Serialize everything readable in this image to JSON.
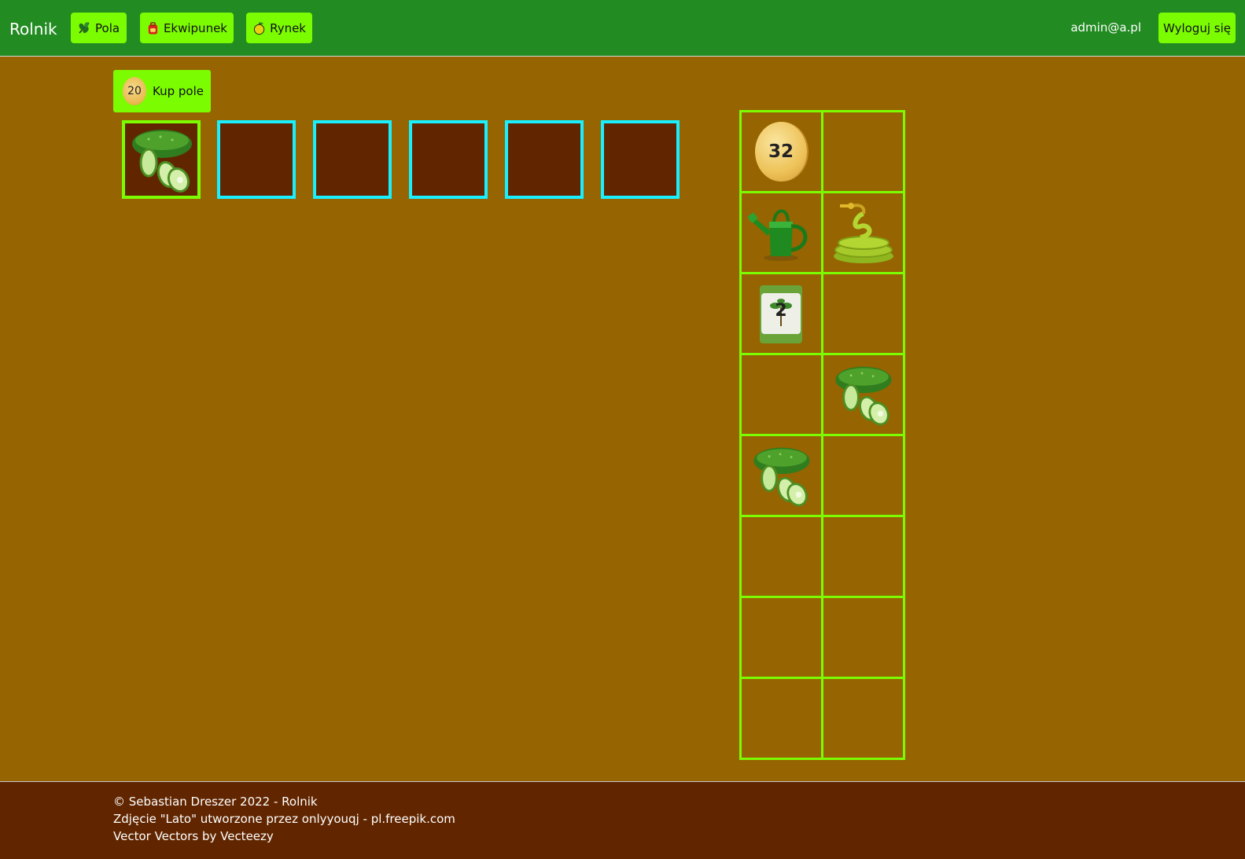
{
  "navbar": {
    "brand": "Rolnik",
    "links": [
      {
        "label": "Pola",
        "icon": "plant-icon"
      },
      {
        "label": "Ekwipunek",
        "icon": "backpack-icon"
      },
      {
        "label": "Rynek",
        "icon": "apple-icon"
      }
    ],
    "user_email": "admin@a.pl",
    "logout_label": "Wyloguj się"
  },
  "fields": {
    "buy_price": "20",
    "buy_label": "Kup pole",
    "plots": [
      {
        "state": "owned",
        "crop": "cucumber"
      },
      {
        "state": "empty"
      },
      {
        "state": "empty"
      },
      {
        "state": "empty"
      },
      {
        "state": "empty"
      },
      {
        "state": "empty"
      }
    ]
  },
  "inventory": {
    "slots": [
      {
        "item": "coin",
        "amount": "32"
      },
      {
        "item": "empty"
      },
      {
        "item": "watering-can"
      },
      {
        "item": "garden-hose"
      },
      {
        "item": "seed-bag",
        "amount": "2"
      },
      {
        "item": "empty"
      },
      {
        "item": "empty"
      },
      {
        "item": "cucumber"
      },
      {
        "item": "cucumber"
      },
      {
        "item": "empty"
      },
      {
        "item": "empty"
      },
      {
        "item": "empty"
      },
      {
        "item": "empty"
      },
      {
        "item": "empty"
      },
      {
        "item": "empty"
      },
      {
        "item": "empty"
      }
    ]
  },
  "footer": {
    "copyright": "© Sebastian Dreszer 2022 - Rolnik",
    "photo_credit": "Zdjęcie \"Lato\" utworzone przez onlyyouqj - pl.freepik.com",
    "vector_credit": "Vector Vectors by Vecteezy"
  },
  "colors": {
    "navbar": "#228b22",
    "accent_button": "#7cfc00",
    "background": "#966400",
    "field_soil": "#612600",
    "empty_field_border": "#18f0ff",
    "footer": "#612600"
  }
}
